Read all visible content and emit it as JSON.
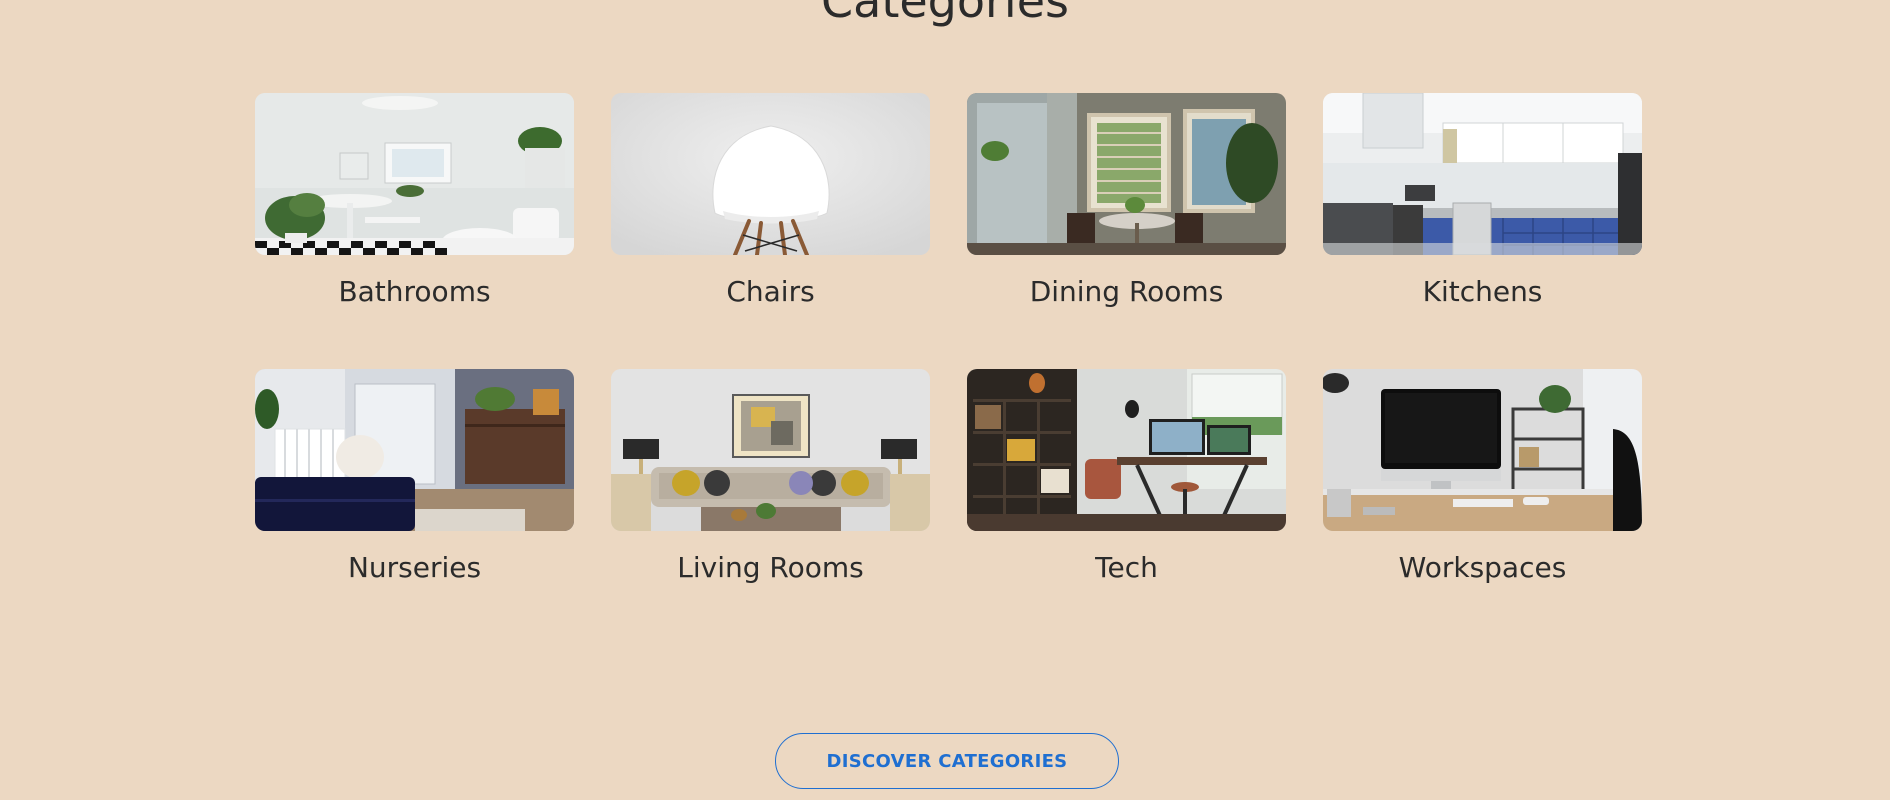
{
  "section": {
    "title": "Categories"
  },
  "categories": [
    {
      "label": "Bathrooms",
      "image": "bathroom-photo"
    },
    {
      "label": "Chairs",
      "image": "white-chair-photo"
    },
    {
      "label": "Dining Rooms",
      "image": "dining-room-photo"
    },
    {
      "label": "Kitchens",
      "image": "kitchen-photo"
    },
    {
      "label": "Nurseries",
      "image": "nursery-photo"
    },
    {
      "label": "Living Rooms",
      "image": "living-room-photo"
    },
    {
      "label": "Tech",
      "image": "tech-desk-photo"
    },
    {
      "label": "Workspaces",
      "image": "workspace-photo"
    }
  ],
  "cta": {
    "label": "DISCOVER CATEGORIES"
  },
  "colors": {
    "background": "#ecd8c2",
    "text": "#2b2b2b",
    "accent": "#1f6fd1"
  }
}
